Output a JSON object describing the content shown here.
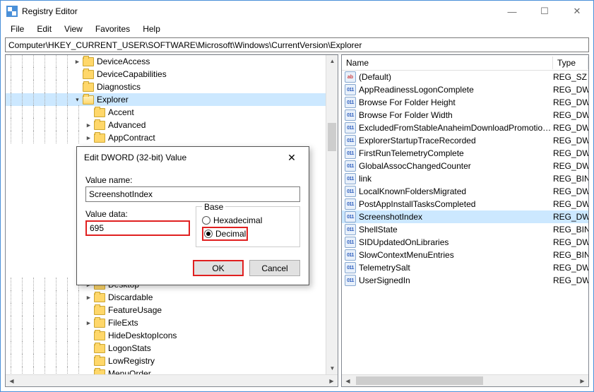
{
  "window": {
    "title": "Registry Editor"
  },
  "menubar": [
    "File",
    "Edit",
    "View",
    "Favorites",
    "Help"
  ],
  "addressbar": "Computer\\HKEY_CURRENT_USER\\SOFTWARE\\Microsoft\\Windows\\CurrentVersion\\Explorer",
  "tree": [
    {
      "depth": 6,
      "exp": "collapsed",
      "label": "DeviceAccess"
    },
    {
      "depth": 6,
      "exp": "none",
      "label": "DeviceCapabilities"
    },
    {
      "depth": 6,
      "exp": "none",
      "label": "Diagnostics"
    },
    {
      "depth": 6,
      "exp": "expanded",
      "label": "Explorer",
      "selected": true,
      "open": true
    },
    {
      "depth": 7,
      "exp": "none",
      "label": "Accent"
    },
    {
      "depth": 7,
      "exp": "collapsed",
      "label": "Advanced"
    },
    {
      "depth": 7,
      "exp": "collapsed",
      "label": "AppContract"
    },
    {
      "depth": 7,
      "exp": "collapsed",
      "label": "Desktop"
    },
    {
      "depth": 7,
      "exp": "collapsed",
      "label": "Discardable"
    },
    {
      "depth": 7,
      "exp": "none",
      "label": "FeatureUsage"
    },
    {
      "depth": 7,
      "exp": "collapsed",
      "label": "FileExts"
    },
    {
      "depth": 7,
      "exp": "none",
      "label": "HideDesktopIcons"
    },
    {
      "depth": 7,
      "exp": "none",
      "label": "LogonStats"
    },
    {
      "depth": 7,
      "exp": "none",
      "label": "LowRegistry"
    },
    {
      "depth": 7,
      "exp": "none",
      "label": "MenuOrder"
    }
  ],
  "list": {
    "columns": {
      "name": "Name",
      "type": "Type"
    },
    "rows": [
      {
        "icon": "str",
        "name": "(Default)",
        "type": "REG_SZ"
      },
      {
        "icon": "bin",
        "name": "AppReadinessLogonComplete",
        "type": "REG_DWORD"
      },
      {
        "icon": "bin",
        "name": "Browse For Folder Height",
        "type": "REG_DWORD"
      },
      {
        "icon": "bin",
        "name": "Browse For Folder Width",
        "type": "REG_DWORD"
      },
      {
        "icon": "bin",
        "name": "ExcludedFromStableAnaheimDownloadPromotionSL",
        "type": "REG_DWORD"
      },
      {
        "icon": "bin",
        "name": "ExplorerStartupTraceRecorded",
        "type": "REG_DWORD"
      },
      {
        "icon": "bin",
        "name": "FirstRunTelemetryComplete",
        "type": "REG_DWORD"
      },
      {
        "icon": "bin",
        "name": "GlobalAssocChangedCounter",
        "type": "REG_DWORD"
      },
      {
        "icon": "bin",
        "name": "link",
        "type": "REG_BINARY"
      },
      {
        "icon": "bin",
        "name": "LocalKnownFoldersMigrated",
        "type": "REG_DWORD"
      },
      {
        "icon": "bin",
        "name": "PostAppInstallTasksCompleted",
        "type": "REG_DWORD"
      },
      {
        "icon": "bin",
        "name": "ScreenshotIndex",
        "type": "REG_DWORD",
        "selected": true
      },
      {
        "icon": "bin",
        "name": "ShellState",
        "type": "REG_BINARY"
      },
      {
        "icon": "bin",
        "name": "SIDUpdatedOnLibraries",
        "type": "REG_DWORD"
      },
      {
        "icon": "bin",
        "name": "SlowContextMenuEntries",
        "type": "REG_BINARY"
      },
      {
        "icon": "bin",
        "name": "TelemetrySalt",
        "type": "REG_DWORD"
      },
      {
        "icon": "bin",
        "name": "UserSignedIn",
        "type": "REG_DWORD"
      }
    ]
  },
  "dialog": {
    "title": "Edit DWORD (32-bit) Value",
    "valueNameLabel": "Value name:",
    "valueName": "ScreenshotIndex",
    "valueDataLabel": "Value data:",
    "valueData": "695",
    "baseLabel": "Base",
    "hexLabel": "Hexadecimal",
    "decLabel": "Decimal",
    "okLabel": "OK",
    "cancelLabel": "Cancel"
  },
  "iconText": {
    "str": "ab",
    "bin": "011"
  }
}
